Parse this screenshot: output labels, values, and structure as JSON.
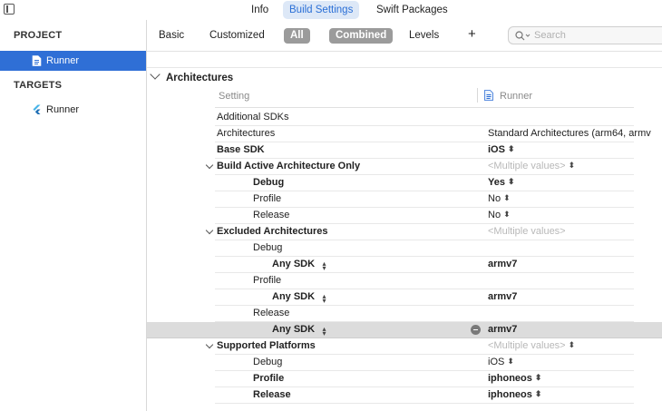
{
  "tabs": {
    "items": [
      {
        "label": "Info",
        "active": false
      },
      {
        "label": "Build Settings",
        "active": true
      },
      {
        "label": "Swift Packages",
        "active": false
      }
    ]
  },
  "sidebar": {
    "project_header": "PROJECT",
    "project_item": "Runner",
    "targets_header": "TARGETS",
    "target_item": "Runner"
  },
  "filter": {
    "basic": "Basic",
    "customized": "Customized",
    "all": "All",
    "combined": "Combined",
    "levels": "Levels",
    "add": "+",
    "search_placeholder": "Search"
  },
  "section": {
    "title": "Architectures",
    "col_setting": "Setting",
    "col_target": "Runner"
  },
  "rows": [
    {
      "label": "Additional SDKs",
      "value": "",
      "bold": false,
      "indent": 0
    },
    {
      "label": "Architectures",
      "value": "Standard Architectures (arm64, armv",
      "bold": false,
      "indent": 0
    },
    {
      "label": "Base SDK",
      "value": "iOS",
      "bold": true,
      "indent": 0,
      "stepper": true
    },
    {
      "label": "Build Active Architecture Only",
      "value": "<Multiple values>",
      "bold": true,
      "indent": 0,
      "group": true,
      "muted": true,
      "stepper": true
    },
    {
      "label": "Debug",
      "value": "Yes",
      "bold": true,
      "indent": 1,
      "stepper": true
    },
    {
      "label": "Profile",
      "value": "No",
      "bold": false,
      "indent": 1,
      "stepper": true
    },
    {
      "label": "Release",
      "value": "No",
      "bold": false,
      "indent": 1,
      "stepper": true
    },
    {
      "label": "Excluded Architectures",
      "value": "<Multiple values>",
      "bold": true,
      "indent": 0,
      "group": true,
      "muted": true
    },
    {
      "label": "Debug",
      "value": "",
      "bold": false,
      "indent": 1
    },
    {
      "label": "Any SDK",
      "value": "armv7",
      "bold": true,
      "indent": 2,
      "label_stepper": true
    },
    {
      "label": "Profile",
      "value": "",
      "bold": false,
      "indent": 1
    },
    {
      "label": "Any SDK",
      "value": "armv7",
      "bold": true,
      "indent": 2,
      "label_stepper": true
    },
    {
      "label": "Release",
      "value": "",
      "bold": false,
      "indent": 1
    },
    {
      "label": "Any SDK",
      "value": "armv7",
      "bold": true,
      "indent": 2,
      "label_stepper": true,
      "highlighted": true
    },
    {
      "label": "Supported Platforms",
      "value": "<Multiple values>",
      "bold": true,
      "indent": 0,
      "group": true,
      "muted": true,
      "stepper": true
    },
    {
      "label": "Debug",
      "value": "iOS",
      "bold": false,
      "indent": 1,
      "stepper": true
    },
    {
      "label": "Profile",
      "value": "iphoneos",
      "bold": true,
      "indent": 1,
      "stepper": true
    },
    {
      "label": "Release",
      "value": "iphoneos",
      "bold": true,
      "indent": 1,
      "stepper": true
    }
  ],
  "colors": {
    "accent": "#2f6fd6",
    "active_tab_bg": "#dde8f7",
    "highlight_row": "#dcdcdc"
  }
}
